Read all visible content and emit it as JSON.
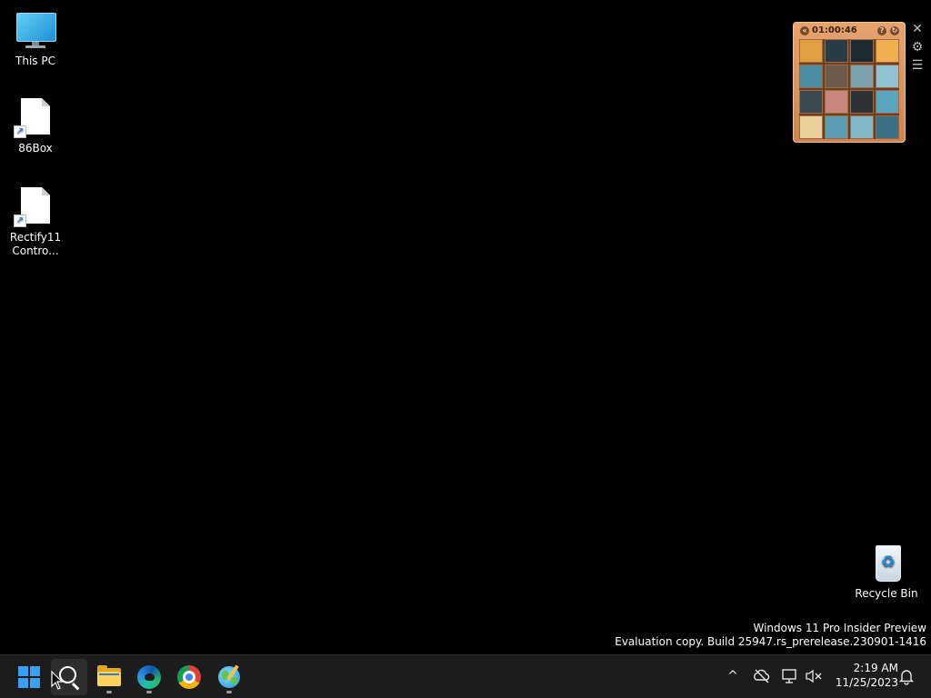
{
  "desktop": {
    "icons": [
      {
        "label": "This PC",
        "icon": "monitor-icon"
      },
      {
        "label": "86Box",
        "icon": "file-shortcut-icon"
      },
      {
        "label": "Rectify11 Contro...",
        "icon": "file-shortcut-icon"
      },
      {
        "label": "Recycle Bin",
        "icon": "recycle-bin-icon"
      }
    ]
  },
  "puzzle_widget": {
    "timer": "01:00:46",
    "close_glyph": "✕",
    "settings_glyph": "⚙",
    "menu_glyph": "☰",
    "help_glyph": "?",
    "back_glyph": "«",
    "refresh_glyph": "↻",
    "tile_colors": [
      "#e0a040",
      "#2b3b45",
      "#1c2a33",
      "#f0b050",
      "#4b8ea3",
      "#6f5a4a",
      "#7aa0ad",
      "#8fc1cf",
      "#3a4a52",
      "#c7877a",
      "#2c3236",
      "#5aa6bf",
      "#e9cf9a",
      "#5c9db4",
      "#7fb7c8",
      "#3b6f86"
    ]
  },
  "watermark": {
    "line1": "Windows 11 Pro Insider Preview",
    "line2": "Evaluation copy. Build 25947.rs_prerelease.230901-1416"
  },
  "taskbar": {
    "pinned": [
      {
        "name": "start-button",
        "icon": "windows-logo-icon"
      },
      {
        "name": "search-button",
        "icon": "search-icon"
      },
      {
        "name": "file-explorer-button",
        "icon": "folder-icon"
      },
      {
        "name": "edge-button",
        "icon": "edge-icon"
      },
      {
        "name": "chrome-button",
        "icon": "chrome-icon"
      },
      {
        "name": "globe-app-button",
        "icon": "globe-icon"
      }
    ],
    "tray": {
      "chevron": "^",
      "notification_glyph": "🔔"
    },
    "clock": {
      "time": "2:19 AM",
      "date": "11/25/2023"
    }
  },
  "colors": {
    "desktop_bg": "#000000",
    "taskbar_bg": "#1c1c1c",
    "accent": "#3aa0f3",
    "puzzle_frame": "#e7a36e"
  }
}
